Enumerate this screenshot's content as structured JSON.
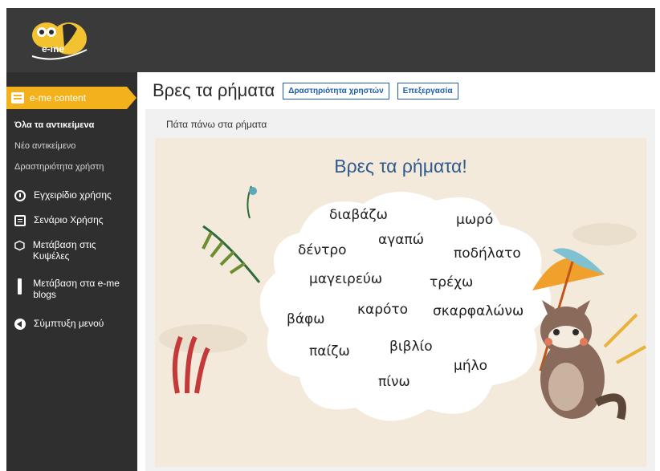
{
  "app": {
    "logo_text": "e-me"
  },
  "sidebar": {
    "active_label": "e-me content",
    "sub_items": [
      "Όλα τα αντικείμενα",
      "Νέο αντικείμενο",
      "Δραστηριότητα χρήστη"
    ],
    "items": [
      {
        "label": "Εγχειρίδιο χρήσης",
        "icon": "info-icon"
      },
      {
        "label": "Σενάριο Χρήσης",
        "icon": "document-icon"
      },
      {
        "label": "Μετάβαση στις Κυψέλες",
        "icon": "hexagon-icon"
      },
      {
        "label": "Μετάβαση στα e-me blogs",
        "icon": "pen-icon"
      },
      {
        "label": "Σύμπτυξη μενού",
        "icon": "collapse-icon"
      }
    ]
  },
  "header": {
    "title": "Βρες τα ρήματα",
    "btn_activity": "Δραστηριότητα χρηστών",
    "btn_edit": "Επεξεργασία"
  },
  "content": {
    "instruction": "Πάτα πάνω στα ρήματα",
    "game_title": "Βρες τα ρήματα!",
    "words": [
      "διαβάζω",
      "μωρό",
      "αγαπώ",
      "δέντρο",
      "ποδήλατο",
      "μαγειρεύω",
      "τρέχω",
      "καρότο",
      "βάφω",
      "σκαρφαλώνω",
      "βιβλίο",
      "παίζω",
      "μήλο",
      "πίνω"
    ]
  },
  "colors": {
    "accent": "#f3b11c",
    "topbar": "#3a3a3a",
    "sidebar": "#2f2f2f",
    "link_blue": "#1f5fa8",
    "game_title": "#2e5a8e"
  }
}
